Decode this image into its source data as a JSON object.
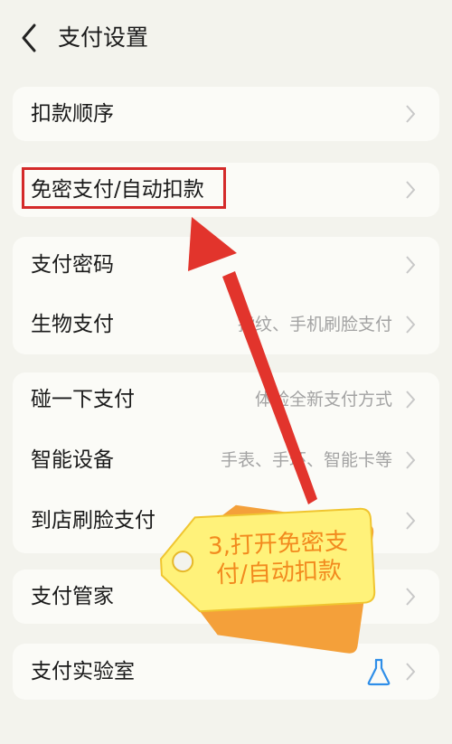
{
  "header": {
    "title": "支付设置"
  },
  "sections": [
    {
      "rows": [
        {
          "label": "扣款顺序",
          "hint": ""
        }
      ]
    },
    {
      "rows": [
        {
          "label": "免密支付/自动扣款",
          "hint": ""
        }
      ]
    },
    {
      "rows": [
        {
          "label": "支付密码",
          "hint": ""
        },
        {
          "label": "生物支付",
          "hint": "指纹、手机刷脸支付"
        }
      ]
    },
    {
      "rows": [
        {
          "label": "碰一下支付",
          "hint": "体验全新支付方式"
        },
        {
          "label": "智能设备",
          "hint": "手表、手环、智能卡等"
        },
        {
          "label": "到店刷脸支付",
          "hint": ""
        }
      ]
    },
    {
      "rows": [
        {
          "label": "支付管家",
          "hint": ""
        }
      ]
    },
    {
      "rows": [
        {
          "label": "支付实验室",
          "hint": "",
          "icon": "flask-icon"
        }
      ]
    }
  ],
  "annotation": {
    "step_text": "3,打开免密支付/自动扣款",
    "colors": {
      "highlight": "#d42a2a",
      "arrow": "#e2342c",
      "tag": "#fff27a",
      "tag_back": "#f4a03a",
      "tag_text": "#f28a1e"
    }
  }
}
